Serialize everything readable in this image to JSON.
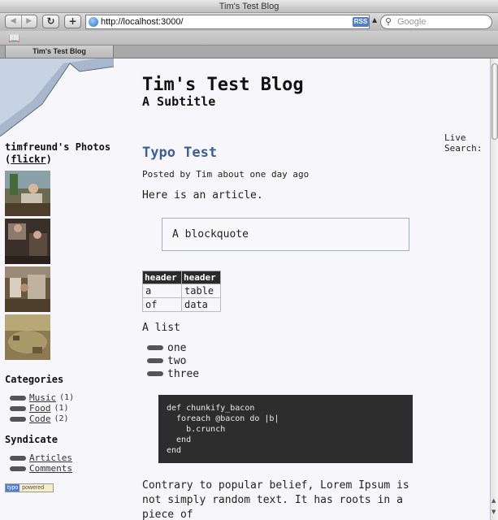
{
  "window": {
    "title": "Tim's Test Blog",
    "back_icon": "back-arrow-icon",
    "forward_icon": "forward-arrow-icon",
    "reload_symbol": "↻",
    "add_symbol": "+",
    "url": "http://localhost:3000/",
    "rss_label": "RSS",
    "search_placeholder": "Google",
    "tab_label": "Tim's Test Blog"
  },
  "header": {
    "title": "Tim's Test Blog",
    "subtitle": "A Subtitle"
  },
  "sidebar": {
    "photos_prefix": "timfreund's Photos",
    "photos_open": "(",
    "photos_link": "flickr",
    "photos_close": ")",
    "categories_heading": "Categories",
    "categories": [
      {
        "label": "Music",
        "count": "(1)"
      },
      {
        "label": "Food",
        "count": "(1)"
      },
      {
        "label": "Code",
        "count": "(2)"
      }
    ],
    "syndicate_heading": "Syndicate",
    "syndicate": [
      {
        "label": "Articles"
      },
      {
        "label": "Comments"
      }
    ],
    "badge": {
      "left": "typo",
      "right": "powered"
    }
  },
  "live_search_label": "Live Search:",
  "article": {
    "title": "Typo Test",
    "meta": "Posted by Tim about one day ago",
    "intro": "Here is an article.",
    "blockquote": "A blockquote",
    "table": {
      "headers": [
        "header",
        "header"
      ],
      "rows": [
        [
          "a",
          "table"
        ],
        [
          "of",
          "data"
        ]
      ]
    },
    "list_intro": "A list",
    "list_items": [
      "one",
      "two",
      "three"
    ],
    "code": "def chunkify_bacon\n  foreach @bacon do |b|\n    b.crunch\n  end\nend",
    "lorem": "Contrary to popular belief, Lorem Ipsum is not simply random text. It has roots in a piece of"
  }
}
